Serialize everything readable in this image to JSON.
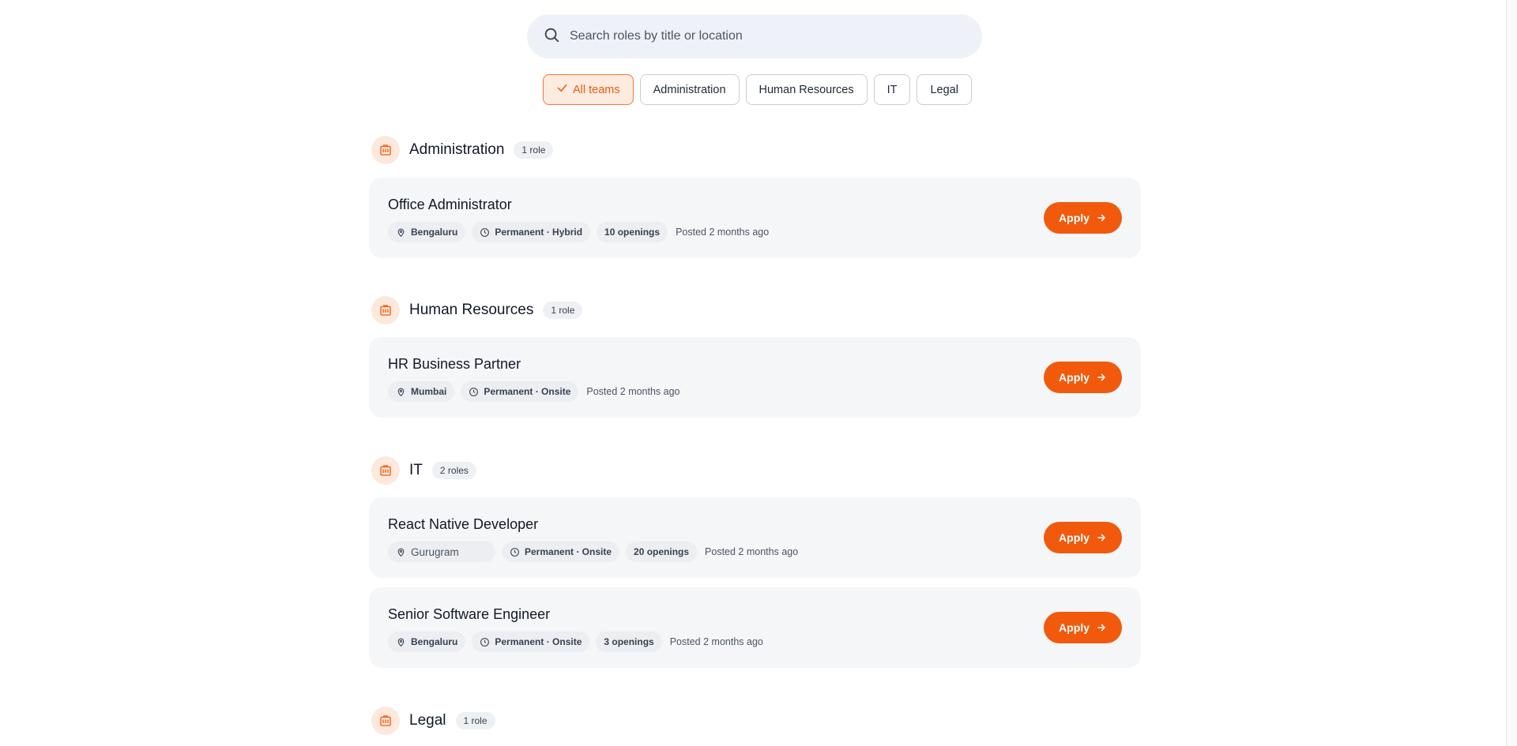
{
  "search": {
    "placeholder": "Search roles by title or location",
    "value": ""
  },
  "filters": {
    "items": [
      "All teams",
      "Administration",
      "Human Resources",
      "IT",
      "Legal"
    ],
    "selected": "All teams"
  },
  "groups": [
    {
      "title": "Administration",
      "count": "1 role",
      "jobs": [
        {
          "title": "Office Administrator",
          "location": "Bengaluru",
          "type": "Permanent · Hybrid",
          "openings": "10 openings",
          "posted": "Posted 2 months ago",
          "apply": "Apply"
        }
      ]
    },
    {
      "title": "Human Resources",
      "count": "1 role",
      "jobs": [
        {
          "title": "HR Business Partner",
          "location": "Mumbai",
          "type": "Permanent · Onsite",
          "openings": "",
          "posted": "Posted 2 months ago",
          "apply": "Apply"
        }
      ]
    },
    {
      "title": "IT",
      "count": "2 roles",
      "jobs": [
        {
          "title": "React Native Developer",
          "location": "Gurugram",
          "type": "Permanent · Onsite",
          "openings": "20 openings",
          "posted": "Posted 2 months ago",
          "apply": "Apply"
        },
        {
          "title": "Senior Software Engineer",
          "location": "Bengaluru",
          "type": "Permanent · Onsite",
          "openings": "3 openings",
          "posted": "Posted 2 months ago",
          "apply": "Apply"
        }
      ]
    },
    {
      "title": "Legal",
      "count": "1 role",
      "jobs": []
    }
  ],
  "colors": {
    "accent": "#f15a0c",
    "accent_soft": "#fde8dd",
    "card_bg": "#f5f6f8"
  },
  "icons": {
    "search": "search-icon",
    "check": "check-icon",
    "building": "building-icon",
    "location": "map-pin-icon",
    "clock": "clock-icon",
    "arrow": "arrow-right-icon"
  }
}
